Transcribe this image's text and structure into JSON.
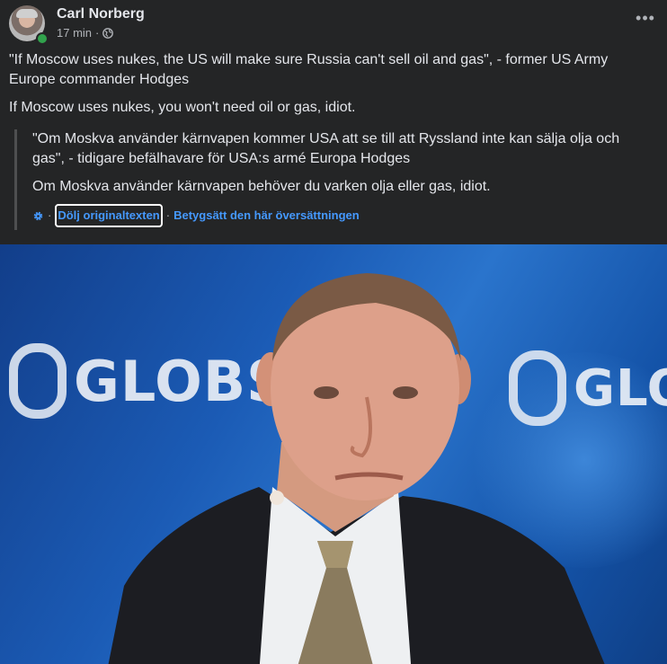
{
  "post": {
    "author": "Carl Norberg",
    "time": "17 min",
    "separator": "·",
    "privacy_icon": "globe-icon",
    "more_label": "•••",
    "paragraphs": [
      "\"If Moscow uses nukes, the US will make sure Russia can't sell oil and gas\", - former US Army Europe commander Hodges",
      "If Moscow uses nukes, you won't need oil or gas, idiot."
    ]
  },
  "translation": {
    "paragraphs": [
      "\"Om Moskva använder kärnvapen kommer USA att se till att Ryssland inte kan sälja olja och gas\", - tidigare befälhavare för USA:s armé Europa Hodges",
      "Om Moskva använder kärnvapen behöver du varken olja eller gas, idiot."
    ],
    "settings_icon": "gear-icon",
    "sep": "·",
    "hide_original": "Dölj originaltexten",
    "rate_translation": "Betygsätt den här översättningen"
  },
  "photo": {
    "logo_left_text": "GLOBSEC",
    "logo_right_text": "GLOBSEC"
  },
  "colors": {
    "background": "#242526",
    "text": "#e4e6eb",
    "secondary": "#b0b3b8",
    "link": "#4599ff",
    "online": "#31a24c"
  }
}
